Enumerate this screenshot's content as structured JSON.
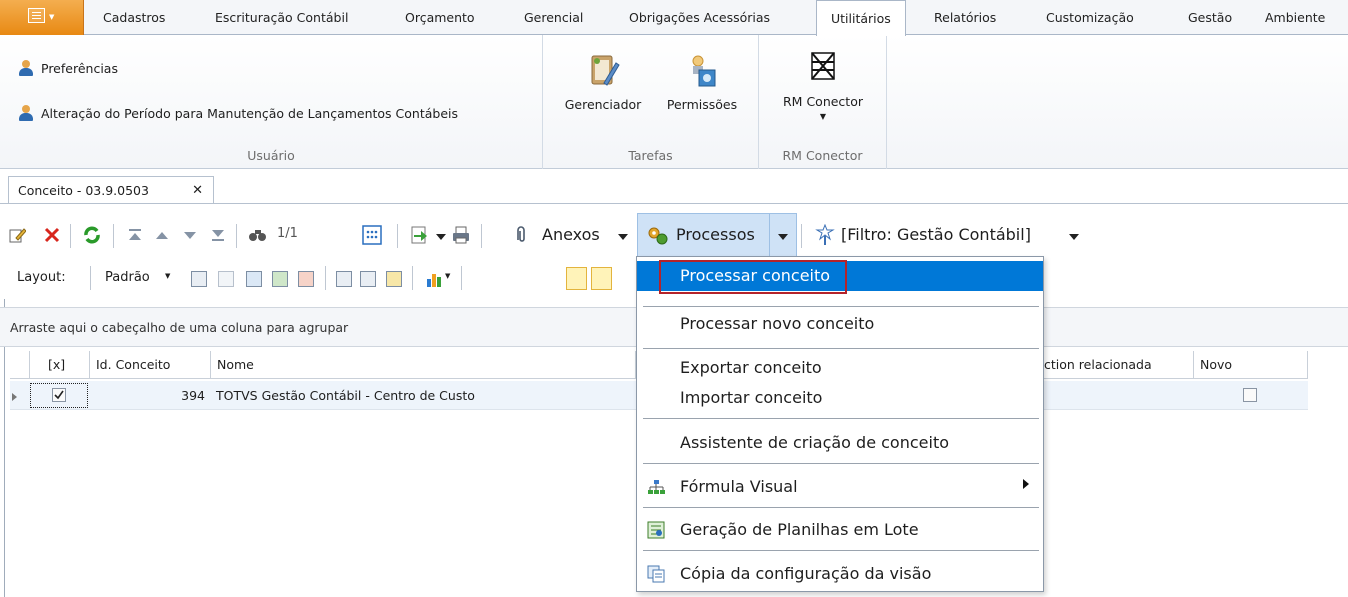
{
  "menu_tabs": [
    "Cadastros",
    "Escrituração Contábil",
    "Orçamento",
    "Gerencial",
    "Obrigações Acessórias",
    "Utilitários",
    "Relatórios",
    "Customização",
    "Gestão",
    "Ambiente"
  ],
  "active_tab": "Utilitários",
  "ribbon": {
    "usuario": {
      "items": [
        "Preferências",
        "Alteração do Período para Manutenção de Lançamentos Contábeis"
      ],
      "label": "Usuário"
    },
    "tarefas": {
      "items": [
        "Gerenciador",
        "Permissões"
      ],
      "label": "Tarefas"
    },
    "rm_conector": {
      "items": [
        "RM Conector"
      ],
      "label": "RM Conector"
    }
  },
  "document_tab": {
    "label": "Conceito - 03.9.0503",
    "close": "✕"
  },
  "toolbar": {
    "record_nav": "1/1",
    "anexos": "Anexos",
    "processos": "Processos",
    "filtro": "[Filtro: Gestão Contábil]"
  },
  "layout_bar": {
    "label": "Layout:",
    "preset": "Padrão"
  },
  "grid": {
    "group_hint": "Arraste aqui o cabeçalho de uma coluna para agrupar",
    "columns": [
      "[x]",
      "Id. Conceito",
      "Nome",
      "ction relacionada",
      "Novo"
    ],
    "rows": [
      {
        "selected": true,
        "id": "394",
        "nome": "TOTVS Gestão Contábil  - Centro de Custo",
        "novo": false
      }
    ]
  },
  "processos_menu": {
    "items": [
      "Processar conceito",
      "Processar novo conceito",
      "Exportar conceito",
      "Importar conceito",
      "Assistente de criação de conceito",
      "Fórmula Visual",
      "Geração de Planilhas em Lote",
      "Cópia da configuração da visão"
    ],
    "highlighted": "Processar conceito"
  },
  "colors": {
    "accent": "#0078d7",
    "app_button": "#e88913",
    "highlight_box": "#b4232a",
    "toolbar_hover": "#cfe2f6"
  }
}
